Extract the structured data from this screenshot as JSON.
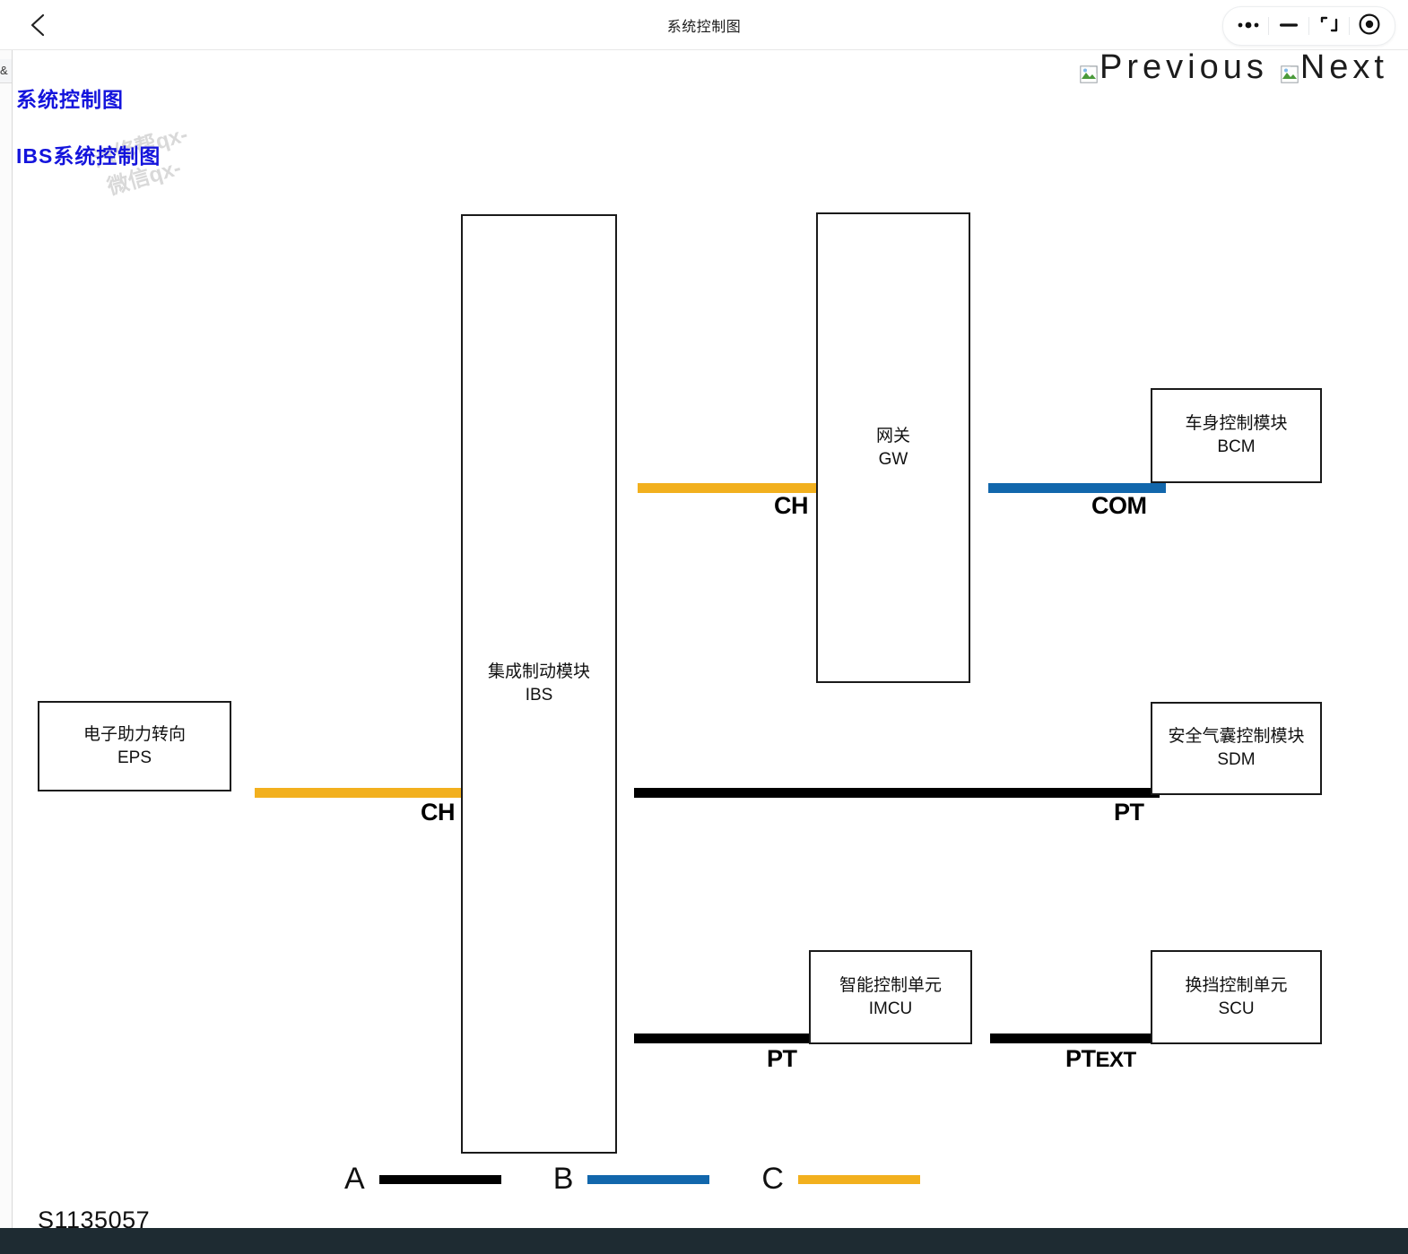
{
  "window": {
    "title": "系统控制图",
    "back_icon": "chevron-left-icon",
    "controls": [
      {
        "name": "more-options-button",
        "icon": "ellipsis-icon"
      },
      {
        "name": "minimize-button",
        "icon": "minus-icon"
      },
      {
        "name": "maximize-button",
        "icon": "expand-icon"
      },
      {
        "name": "close-button",
        "icon": "target-circle-icon"
      }
    ]
  },
  "sidebar_sliver": {
    "truncated_label": "&"
  },
  "page": {
    "heading_1": "系统控制图",
    "heading_2": "IBS系统控制图",
    "figure_id": "S1135057",
    "watermark_line_1": "汽修帮qx-",
    "watermark_line_2": "微信qx-"
  },
  "pager": {
    "previous_label": "Previous",
    "next_label": "Next",
    "icon": "broken-image-icon"
  },
  "colors": {
    "heading_blue": "#1414dc",
    "bus_black": "#000000",
    "bus_blue": "#1267ac",
    "bus_orange": "#f2b01e",
    "node_border": "#1a1a1a",
    "bottom_bar": "#1e2b32"
  },
  "diagram": {
    "nodes": [
      {
        "id": "ibs",
        "cn": "集成制动模块",
        "en": "IBS"
      },
      {
        "id": "gw",
        "cn": "网关",
        "en": "GW"
      },
      {
        "id": "bcm",
        "cn": "车身控制模块",
        "en": "BCM"
      },
      {
        "id": "eps",
        "cn": "电子助力转向",
        "en": "EPS"
      },
      {
        "id": "sdm",
        "cn": "安全气囊控制模块",
        "en": "SDM"
      },
      {
        "id": "imcu",
        "cn": "智能控制单元",
        "en": "IMCU"
      },
      {
        "id": "scu",
        "cn": "换挡控制单元",
        "en": "SCU"
      }
    ],
    "buses": [
      {
        "id": "ibs-gw",
        "label": "CH",
        "color": "orange",
        "from": "ibs",
        "to": "gw"
      },
      {
        "id": "gw-bcm",
        "label": "COM",
        "color": "blue",
        "from": "gw",
        "to": "bcm"
      },
      {
        "id": "eps-ibs",
        "label": "CH",
        "color": "orange",
        "from": "eps",
        "to": "ibs"
      },
      {
        "id": "ibs-sdm",
        "label": "PT",
        "color": "black",
        "from": "ibs",
        "to": "sdm"
      },
      {
        "id": "ibs-imcu",
        "label": "PT",
        "color": "black",
        "from": "ibs",
        "to": "imcu"
      },
      {
        "id": "imcu-scu",
        "label_main": "PT",
        "label_sub": "EXT",
        "color": "black",
        "from": "imcu",
        "to": "scu"
      }
    ]
  },
  "legend": {
    "items": [
      {
        "letter": "A",
        "color": "black"
      },
      {
        "letter": "B",
        "color": "blue"
      },
      {
        "letter": "C",
        "color": "orange"
      }
    ]
  }
}
